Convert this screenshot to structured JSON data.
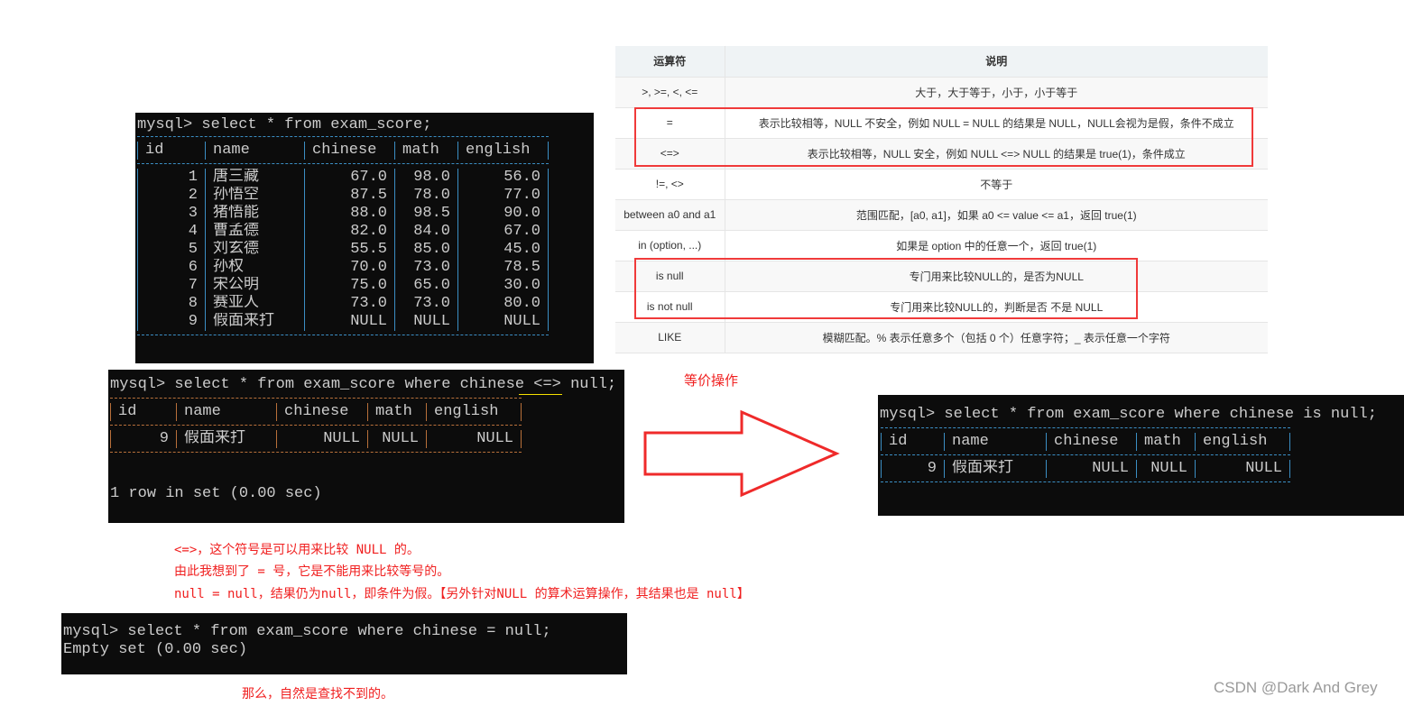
{
  "terminal_full": {
    "prompt": "mysql> select * from exam_score;",
    "columns": [
      "id",
      "name",
      "chinese",
      "math",
      "english"
    ],
    "rows": [
      [
        "1",
        "唐三藏",
        "67.0",
        "98.0",
        "56.0"
      ],
      [
        "2",
        "孙悟空",
        "87.5",
        "78.0",
        "77.0"
      ],
      [
        "3",
        "猪悟能",
        "88.0",
        "98.5",
        "90.0"
      ],
      [
        "4",
        "曹孟德",
        "82.0",
        "84.0",
        "67.0"
      ],
      [
        "5",
        "刘玄德",
        "55.5",
        "85.0",
        "45.0"
      ],
      [
        "6",
        "孙权",
        "70.0",
        "73.0",
        "78.5"
      ],
      [
        "7",
        "宋公明",
        "75.0",
        "65.0",
        "30.0"
      ],
      [
        "8",
        "赛亚人",
        "73.0",
        "73.0",
        "80.0"
      ],
      [
        "9",
        "假面来打",
        "NULL",
        "NULL",
        "NULL"
      ]
    ],
    "border_color": "#3b8ec4"
  },
  "terminal_null_safe": {
    "prompt": "mysql> select * from exam_score where chinese <=> null;",
    "columns": [
      "id",
      "name",
      "chinese",
      "math",
      "english"
    ],
    "rows": [
      [
        "9",
        "假面来打",
        "NULL",
        "NULL",
        "NULL"
      ]
    ],
    "footer": "1 row in set (0.00 sec)",
    "border_color": "#b8703a",
    "underline_color": "#f5e000"
  },
  "terminal_is_null": {
    "prompt": "mysql> select * from exam_score where chinese is null;",
    "columns": [
      "id",
      "name",
      "chinese",
      "math",
      "english"
    ],
    "rows": [
      [
        "9",
        "假面来打",
        "NULL",
        "NULL",
        "NULL"
      ]
    ],
    "border_color": "#3b8ec4"
  },
  "terminal_equals": {
    "prompt": "mysql> select * from exam_score where chinese = null;",
    "footer": "Empty set (0.00 sec)"
  },
  "operators_table": {
    "headers": [
      "运算符",
      "说明"
    ],
    "rows": [
      [
        ">, >=, <, <=",
        "大于，大于等于，小于，小于等于"
      ],
      [
        "=",
        "表示比较相等，NULL 不安全，例如 NULL = NULL 的结果是 NULL，NULL会视为是假，条件不成立"
      ],
      [
        "<=>",
        "表示比较相等，NULL 安全，例如 NULL <=> NULL 的结果是 true(1)，条件成立"
      ],
      [
        "!=, <>",
        "不等于"
      ],
      [
        "between a0 and a1",
        "范围匹配，[a0, a1]，如果 a0 <= value <= a1，返回 true(1)"
      ],
      [
        "in (option, ...)",
        "如果是 option 中的任意一个，返回 true(1)"
      ],
      [
        "is null",
        "专门用来比较NULL的，是否为NULL"
      ],
      [
        "is not null",
        "专门用来比较NULL的，判断是否 不是 NULL"
      ],
      [
        "LIKE",
        "模糊匹配。% 表示任意多个（包括 0 个）任意字符；_ 表示任意一个字符"
      ]
    ]
  },
  "annotations": {
    "equivalent": "等价操作",
    "note1": "<=>，这个符号是可以用来比较 NULL 的。",
    "note2": "由此我想到了 = 号，它是不能用来比较等号的。",
    "note3": "null = null，结果仍为null，即条件为假。【另外针对NULL 的算术运算操作，其结果也是 null】",
    "note4": "那么，自然是查找不到的。",
    "color": "#f02020"
  },
  "arrow_icon": "right-arrow-outline",
  "watermark": "CSDN @Dark And Grey"
}
